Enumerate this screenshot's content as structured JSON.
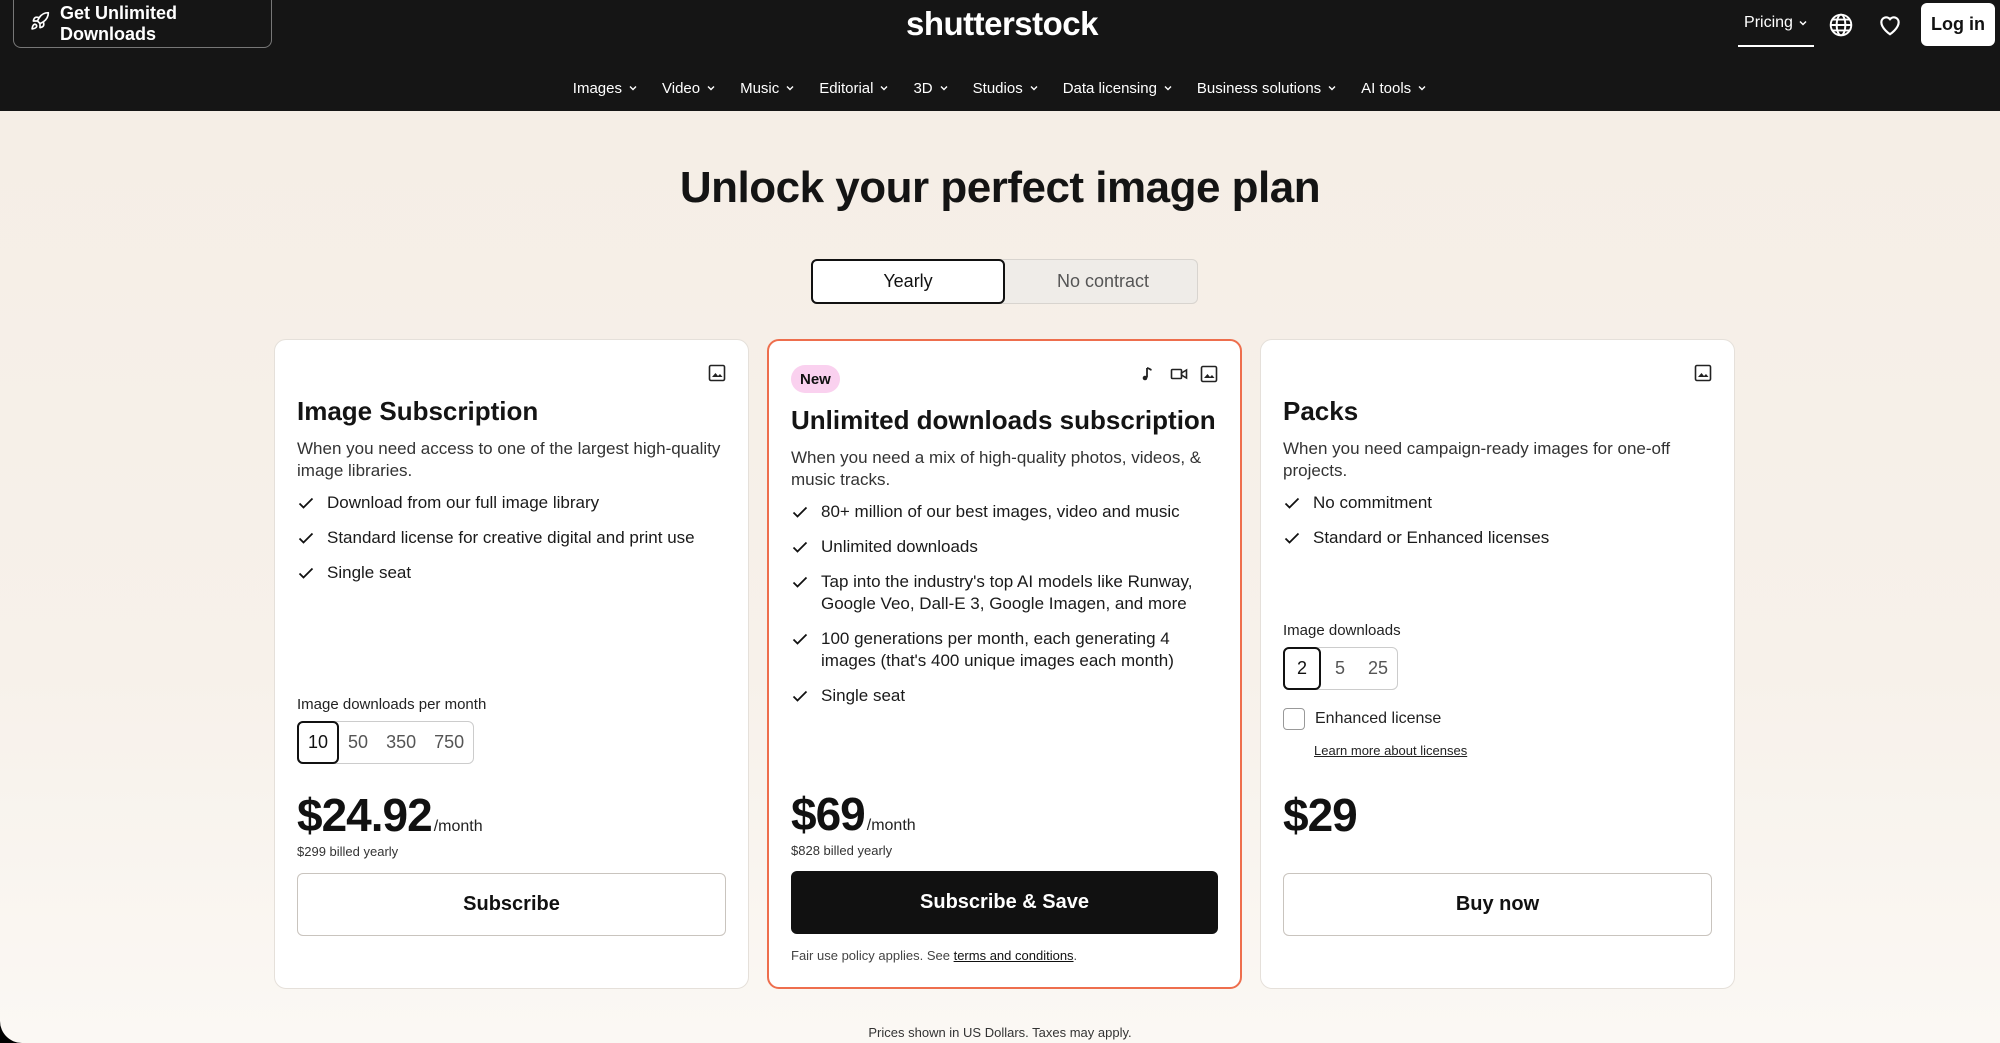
{
  "header": {
    "promo_label": "Get Unlimited Downloads",
    "logo": "shutterstock",
    "pricing_label": "Pricing",
    "login_label": "Log in",
    "icons": [
      "rocket-icon",
      "globe-icon",
      "heart-icon"
    ]
  },
  "nav": {
    "items": [
      "Images",
      "Video",
      "Music",
      "Editorial",
      "3D",
      "Studios",
      "Data licensing",
      "Business solutions",
      "AI tools"
    ]
  },
  "main": {
    "title": "Unlock your perfect image plan",
    "toggle": {
      "yearly": "Yearly",
      "no_contract": "No contract",
      "selected": "Yearly"
    }
  },
  "plans": {
    "image_sub": {
      "title": "Image Subscription",
      "desc": "When you need access to one of the largest high-quality image libraries.",
      "features": [
        "Download from our full image library",
        "Standard license for creative digital and print use",
        "Single seat"
      ],
      "option_label": "Image downloads per month",
      "options": [
        "10",
        "50",
        "350",
        "750"
      ],
      "selected": "10",
      "price": "$24.92",
      "per": "/month",
      "billed": "$299 billed yearly",
      "cta": "Subscribe"
    },
    "unlimited": {
      "badge": "New",
      "title": "Unlimited downloads subscription",
      "desc": "When you need a mix of high-quality photos, videos, & music tracks.",
      "features": [
        "80+ million of our best images, video and music",
        "Unlimited downloads",
        "Tap into the industry's top AI models like Runway, Google Veo, Dall-E 3, Google Imagen, and more",
        "100 generations per month, each generating 4 images (that's 400 unique images each month)",
        "Single seat"
      ],
      "price": "$69",
      "per": "/month",
      "billed": "$828 billed yearly",
      "cta": "Subscribe & Save",
      "fine_prefix": "Fair use policy applies. See ",
      "fine_link": "terms and conditions",
      "fine_suffix": "."
    },
    "packs": {
      "title": "Packs",
      "desc": "When you need campaign-ready images for one-off projects.",
      "features": [
        "No commitment",
        "Standard or Enhanced licenses"
      ],
      "option_label": "Image downloads",
      "options": [
        "2",
        "5",
        "25"
      ],
      "selected": "2",
      "enhanced_label": "Enhanced license",
      "enhanced_checked": false,
      "learn_link": "Learn more about licenses",
      "price": "$29",
      "cta": "Buy now"
    }
  },
  "footer": {
    "note": "Prices shown in US Dollars. Taxes may apply."
  },
  "colors": {
    "header_bg": "#151515",
    "featured_border": "#ee6e4d",
    "badge_bg": "#fad1ef"
  }
}
